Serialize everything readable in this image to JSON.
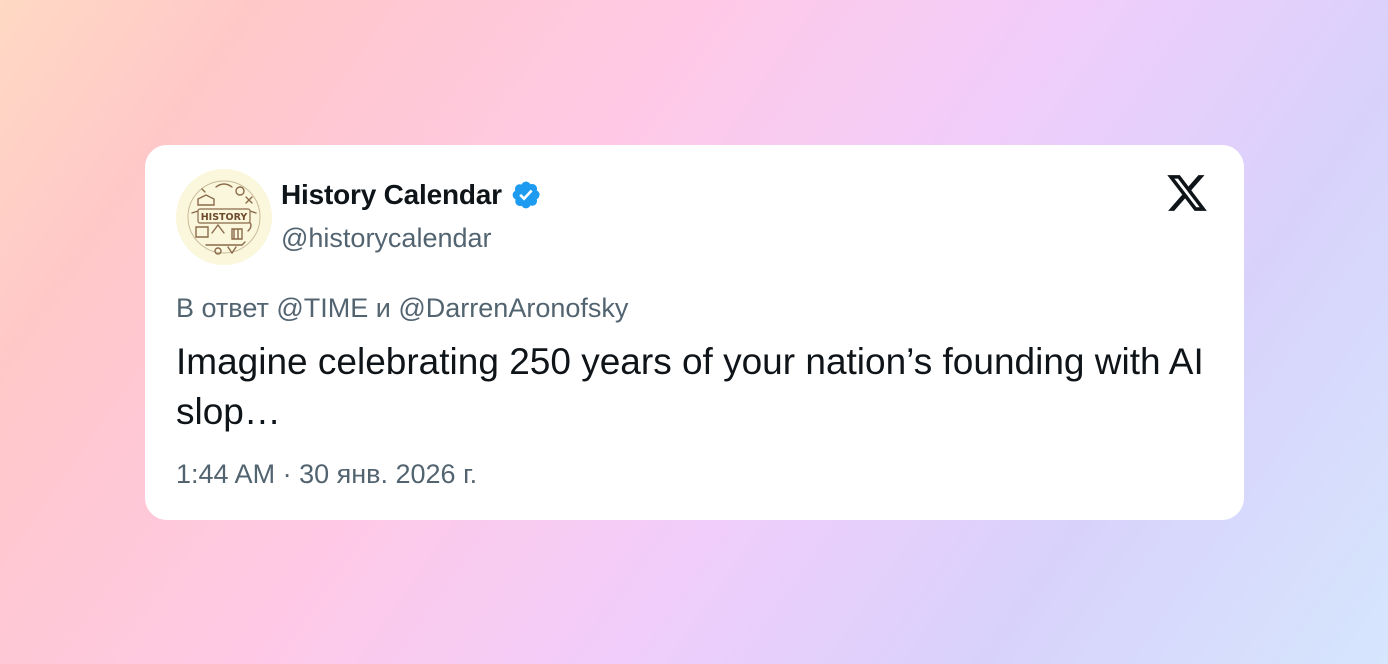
{
  "author": {
    "display_name": "History Calendar",
    "handle": "@historycalendar",
    "verified": true,
    "avatar_text": "HISTORY",
    "avatar_icon": "history-calendar-avatar"
  },
  "reply": {
    "prefix": "В ответ",
    "mention_1": "@TIME",
    "conjunction": "и",
    "mention_2": "@DarrenAronofsky"
  },
  "tweet": {
    "text": "Imagine celebrating 250 years of your nation’s founding with AI slop…"
  },
  "meta": {
    "time": "1:44 AM",
    "separator": "·",
    "date": "30 янв. 2026 г."
  },
  "branding": {
    "logo": "x-logo-icon"
  },
  "colors": {
    "verified_blue": "#1d9bf0",
    "text_primary": "#0f1419",
    "text_secondary": "#536471",
    "card_background": "#ffffff"
  }
}
